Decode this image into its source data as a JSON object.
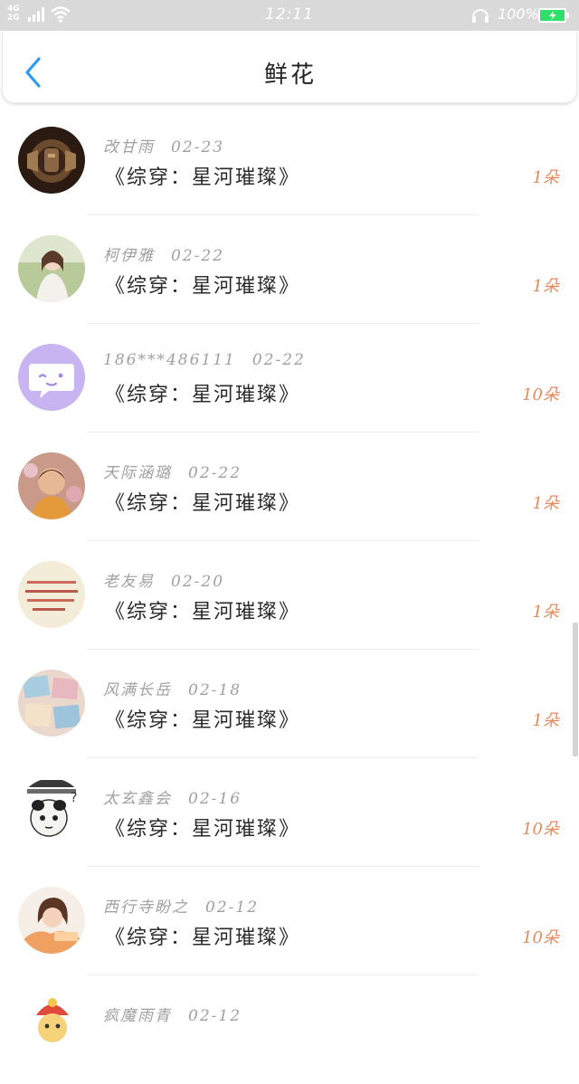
{
  "status_bar": {
    "network_top": "4G",
    "network_bottom": "2G",
    "time": "12:11",
    "battery": "100%"
  },
  "nav": {
    "title": "鲜花"
  },
  "colors": {
    "accent_blue": "#2d9cf0",
    "count_orange": "#e8895a",
    "battery_green": "#2ee06a"
  },
  "rows": [
    {
      "name": "改甘雨",
      "date": "02-23",
      "book": "《综穿：星河璀璨》",
      "count": "1朵"
    },
    {
      "name": "柯伊雅",
      "date": "02-22",
      "book": "《综穿：星河璀璨》",
      "count": "1朵"
    },
    {
      "name": "186***486111",
      "date": "02-22",
      "book": "《综穿：星河璀璨》",
      "count": "10朵"
    },
    {
      "name": "天际涵璐",
      "date": "02-22",
      "book": "《综穿：星河璀璨》",
      "count": "1朵"
    },
    {
      "name": "老友易",
      "date": "02-20",
      "book": "《综穿：星河璀璨》",
      "count": "1朵"
    },
    {
      "name": "风满长岳",
      "date": "02-18",
      "book": "《综穿：星河璀璨》",
      "count": "1朵"
    },
    {
      "name": "太玄鑫会",
      "date": "02-16",
      "book": "《综穿：星河璀璨》",
      "count": "10朵"
    },
    {
      "name": "西行寺盼之",
      "date": "02-12",
      "book": "《综穿：星河璀璨》",
      "count": "10朵"
    },
    {
      "name": "疯魔雨青",
      "date": "02-12",
      "book": "",
      "count": ""
    }
  ]
}
